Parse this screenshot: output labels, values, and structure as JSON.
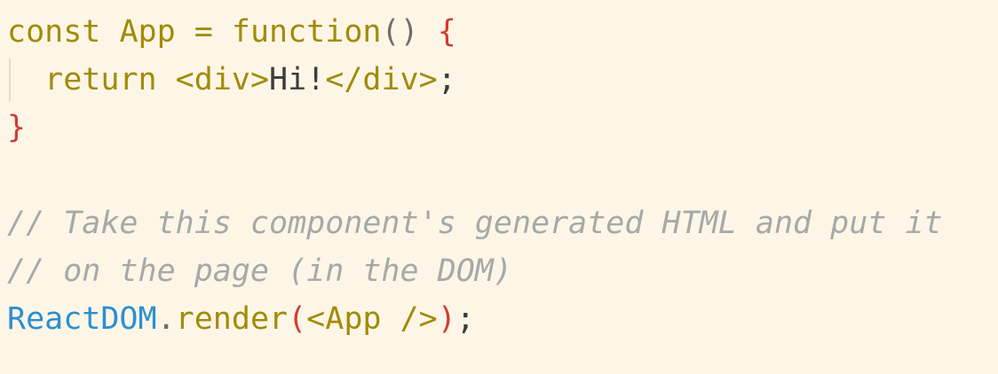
{
  "code": {
    "line1": {
      "kw_const": "const",
      "name": "App",
      "eq": "=",
      "kw_function": "function",
      "parens": "()",
      "open_brace": "{"
    },
    "line2": {
      "indent": "  ",
      "kw_return": "return",
      "open_tag": "<div>",
      "text": "Hi!",
      "close_tag": "</div>",
      "semi": ";"
    },
    "line3": {
      "close_brace": "}"
    },
    "line4": {
      "comment": "// Take this component's generated HTML and put it"
    },
    "line5": {
      "comment": "// on the page (in the DOM)"
    },
    "line6": {
      "object": "ReactDOM",
      "dot": ".",
      "method": "render",
      "open_paren": "(",
      "jsx": "<App />",
      "close_paren": ")",
      "semi": ";"
    }
  },
  "colors": {
    "background": "#fdf6e7",
    "keyword": "#a28b06",
    "brace": "#d23a30",
    "comment": "#a6a9a8",
    "object": "#2c8fd1"
  }
}
